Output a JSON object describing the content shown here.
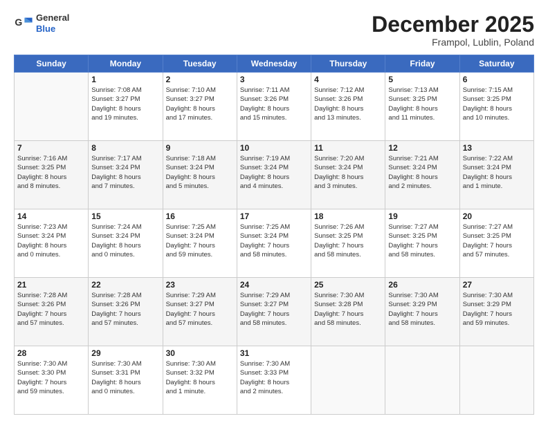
{
  "logo": {
    "general": "General",
    "blue": "Blue"
  },
  "header": {
    "month": "December 2025",
    "location": "Frampol, Lublin, Poland"
  },
  "weekdays": [
    "Sunday",
    "Monday",
    "Tuesday",
    "Wednesday",
    "Thursday",
    "Friday",
    "Saturday"
  ],
  "weeks": [
    [
      {
        "day": "",
        "info": ""
      },
      {
        "day": "1",
        "info": "Sunrise: 7:08 AM\nSunset: 3:27 PM\nDaylight: 8 hours\nand 19 minutes."
      },
      {
        "day": "2",
        "info": "Sunrise: 7:10 AM\nSunset: 3:27 PM\nDaylight: 8 hours\nand 17 minutes."
      },
      {
        "day": "3",
        "info": "Sunrise: 7:11 AM\nSunset: 3:26 PM\nDaylight: 8 hours\nand 15 minutes."
      },
      {
        "day": "4",
        "info": "Sunrise: 7:12 AM\nSunset: 3:26 PM\nDaylight: 8 hours\nand 13 minutes."
      },
      {
        "day": "5",
        "info": "Sunrise: 7:13 AM\nSunset: 3:25 PM\nDaylight: 8 hours\nand 11 minutes."
      },
      {
        "day": "6",
        "info": "Sunrise: 7:15 AM\nSunset: 3:25 PM\nDaylight: 8 hours\nand 10 minutes."
      }
    ],
    [
      {
        "day": "7",
        "info": "Sunrise: 7:16 AM\nSunset: 3:25 PM\nDaylight: 8 hours\nand 8 minutes."
      },
      {
        "day": "8",
        "info": "Sunrise: 7:17 AM\nSunset: 3:24 PM\nDaylight: 8 hours\nand 7 minutes."
      },
      {
        "day": "9",
        "info": "Sunrise: 7:18 AM\nSunset: 3:24 PM\nDaylight: 8 hours\nand 5 minutes."
      },
      {
        "day": "10",
        "info": "Sunrise: 7:19 AM\nSunset: 3:24 PM\nDaylight: 8 hours\nand 4 minutes."
      },
      {
        "day": "11",
        "info": "Sunrise: 7:20 AM\nSunset: 3:24 PM\nDaylight: 8 hours\nand 3 minutes."
      },
      {
        "day": "12",
        "info": "Sunrise: 7:21 AM\nSunset: 3:24 PM\nDaylight: 8 hours\nand 2 minutes."
      },
      {
        "day": "13",
        "info": "Sunrise: 7:22 AM\nSunset: 3:24 PM\nDaylight: 8 hours\nand 1 minute."
      }
    ],
    [
      {
        "day": "14",
        "info": "Sunrise: 7:23 AM\nSunset: 3:24 PM\nDaylight: 8 hours\nand 0 minutes."
      },
      {
        "day": "15",
        "info": "Sunrise: 7:24 AM\nSunset: 3:24 PM\nDaylight: 8 hours\nand 0 minutes."
      },
      {
        "day": "16",
        "info": "Sunrise: 7:25 AM\nSunset: 3:24 PM\nDaylight: 7 hours\nand 59 minutes."
      },
      {
        "day": "17",
        "info": "Sunrise: 7:25 AM\nSunset: 3:24 PM\nDaylight: 7 hours\nand 58 minutes."
      },
      {
        "day": "18",
        "info": "Sunrise: 7:26 AM\nSunset: 3:25 PM\nDaylight: 7 hours\nand 58 minutes."
      },
      {
        "day": "19",
        "info": "Sunrise: 7:27 AM\nSunset: 3:25 PM\nDaylight: 7 hours\nand 58 minutes."
      },
      {
        "day": "20",
        "info": "Sunrise: 7:27 AM\nSunset: 3:25 PM\nDaylight: 7 hours\nand 57 minutes."
      }
    ],
    [
      {
        "day": "21",
        "info": "Sunrise: 7:28 AM\nSunset: 3:26 PM\nDaylight: 7 hours\nand 57 minutes."
      },
      {
        "day": "22",
        "info": "Sunrise: 7:28 AM\nSunset: 3:26 PM\nDaylight: 7 hours\nand 57 minutes."
      },
      {
        "day": "23",
        "info": "Sunrise: 7:29 AM\nSunset: 3:27 PM\nDaylight: 7 hours\nand 57 minutes."
      },
      {
        "day": "24",
        "info": "Sunrise: 7:29 AM\nSunset: 3:27 PM\nDaylight: 7 hours\nand 58 minutes."
      },
      {
        "day": "25",
        "info": "Sunrise: 7:30 AM\nSunset: 3:28 PM\nDaylight: 7 hours\nand 58 minutes."
      },
      {
        "day": "26",
        "info": "Sunrise: 7:30 AM\nSunset: 3:29 PM\nDaylight: 7 hours\nand 58 minutes."
      },
      {
        "day": "27",
        "info": "Sunrise: 7:30 AM\nSunset: 3:29 PM\nDaylight: 7 hours\nand 59 minutes."
      }
    ],
    [
      {
        "day": "28",
        "info": "Sunrise: 7:30 AM\nSunset: 3:30 PM\nDaylight: 7 hours\nand 59 minutes."
      },
      {
        "day": "29",
        "info": "Sunrise: 7:30 AM\nSunset: 3:31 PM\nDaylight: 8 hours\nand 0 minutes."
      },
      {
        "day": "30",
        "info": "Sunrise: 7:30 AM\nSunset: 3:32 PM\nDaylight: 8 hours\nand 1 minute."
      },
      {
        "day": "31",
        "info": "Sunrise: 7:30 AM\nSunset: 3:33 PM\nDaylight: 8 hours\nand 2 minutes."
      },
      {
        "day": "",
        "info": ""
      },
      {
        "day": "",
        "info": ""
      },
      {
        "day": "",
        "info": ""
      }
    ]
  ]
}
